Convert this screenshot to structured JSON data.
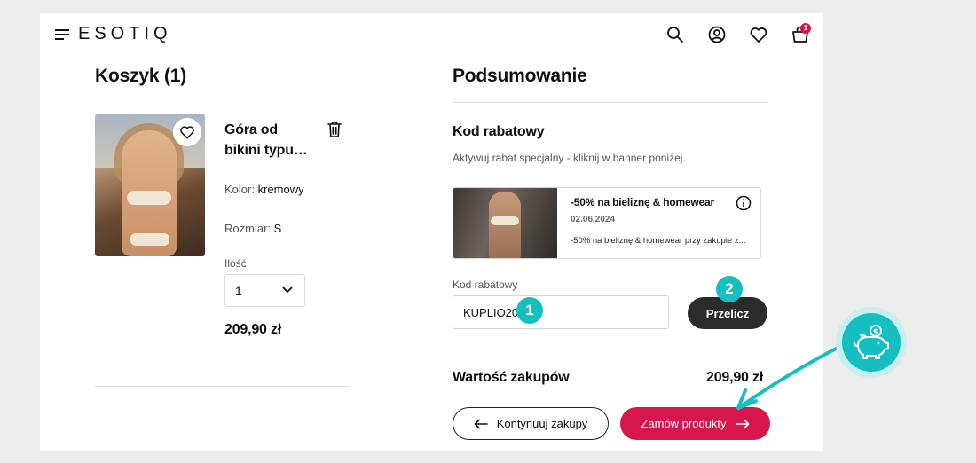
{
  "header": {
    "logo": "ESOTIQ",
    "cart_badge": "1"
  },
  "cart": {
    "title": "Koszyk (1)",
    "product": {
      "name": "Góra od bikini typu…",
      "color_label": "Kolor:",
      "color_value": "kremowy",
      "size_label": "Rozmiar:",
      "size_value": "S",
      "qty_label": "Ilość",
      "qty_value": "1",
      "price": "209,90 zł"
    }
  },
  "summary": {
    "title": "Podsumowanie",
    "discount_heading": "Kod rabatowy",
    "discount_hint": "Aktywuj rabat specjalny - kliknij w banner poniżej.",
    "promo": {
      "title": "-50% na bieliznę & homewear",
      "date": "02.06.2024",
      "description": "-50% na bieliznę & homewear przy zakupie z..."
    },
    "code_label": "Kod rabatowy",
    "code_value": "KUPLIO20",
    "recalc_button": "Przelicz",
    "total_label": "Wartość zakupów",
    "total_value": "209,90 zł",
    "continue_button": "Kontynuuj zakupy",
    "order_button": "Zamów produkty"
  },
  "steps": {
    "step1": "1",
    "step2": "2"
  },
  "colors": {
    "accent_red": "#d6164c",
    "step_teal": "#15bfc0",
    "dark_button": "#2b2b2b"
  }
}
